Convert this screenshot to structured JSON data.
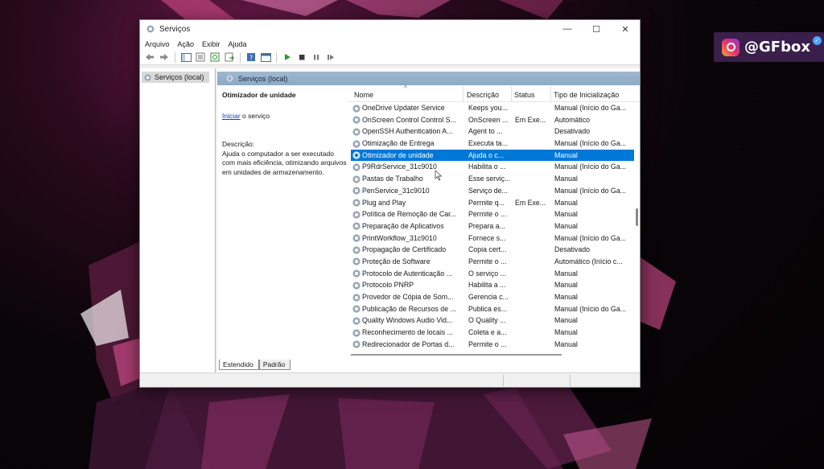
{
  "window": {
    "title": "Serviços",
    "menu": [
      "Arquivo",
      "Ação",
      "Exibir",
      "Ajuda"
    ]
  },
  "tree": {
    "root_label": "Serviços (local)"
  },
  "content": {
    "header": "Serviços (local)",
    "description_pane": {
      "service_title": "Otimizador de unidade",
      "start_link": "Iniciar",
      "start_suffix": " o serviço",
      "description_label": "Descrição:",
      "description_text": "Ajuda o computador a ser executado com mais eficiência, otimizando arquivos em unidades de armazenamento."
    },
    "columns": {
      "name": "Nome",
      "description": "Descrição",
      "status": "Status",
      "startup_type": "Tipo de Inicialização"
    },
    "services": [
      {
        "name": "OneDrive Updater Service",
        "description": "Keeps you...",
        "status": "",
        "startup": "Manual (Início do Ga..."
      },
      {
        "name": "OnScreen Control Control S...",
        "description": "OnScreen ...",
        "status": "Em Exe...",
        "startup": "Automático"
      },
      {
        "name": "OpenSSH Authentication A...",
        "description": "Agent to ...",
        "status": "",
        "startup": "Desativado"
      },
      {
        "name": "Otimização de Entrega",
        "description": "Executa ta...",
        "status": "",
        "startup": "Manual (Início do Ga..."
      },
      {
        "name": "Otimizador de unidade",
        "description": "Ajuda o c...",
        "status": "",
        "startup": "Manual",
        "selected": true
      },
      {
        "name": "P9RdrService_31c9010",
        "description": "Habilita o ...",
        "status": "",
        "startup": "Manual (Início do Ga..."
      },
      {
        "name": "Pastas de Trabalho",
        "description": "Esse serviç...",
        "status": "",
        "startup": "Manual"
      },
      {
        "name": "PenService_31c9010",
        "description": "Serviço de...",
        "status": "",
        "startup": "Manual (Início do Ga..."
      },
      {
        "name": "Plug and Play",
        "description": "Permite q...",
        "status": "Em Exe...",
        "startup": "Manual"
      },
      {
        "name": "Política de Remoção de Car...",
        "description": "Permite o ...",
        "status": "",
        "startup": "Manual"
      },
      {
        "name": "Preparação de Aplicativos",
        "description": "Prepara a...",
        "status": "",
        "startup": "Manual"
      },
      {
        "name": "PrintWorkflow_31c9010",
        "description": "Fornece s...",
        "status": "",
        "startup": "Manual (Início do Ga..."
      },
      {
        "name": "Propagação de Certificado",
        "description": "Copia cert...",
        "status": "",
        "startup": "Desativado"
      },
      {
        "name": "Proteção de Software",
        "description": "Permite o ...",
        "status": "",
        "startup": "Automático (Início c..."
      },
      {
        "name": "Protocolo de Autenticação ...",
        "description": "O serviço ...",
        "status": "",
        "startup": "Manual"
      },
      {
        "name": "Protocolo PNRP",
        "description": "Habilita a ...",
        "status": "",
        "startup": "Manual"
      },
      {
        "name": "Provedor de Cópia de Som...",
        "description": "Gerencia c...",
        "status": "",
        "startup": "Manual"
      },
      {
        "name": "Publicação de Recursos de ...",
        "description": "Publica es...",
        "status": "",
        "startup": "Manual (Início do Ga..."
      },
      {
        "name": "Quality Windows Audio Vid...",
        "description": "O Quality ...",
        "status": "",
        "startup": "Manual"
      },
      {
        "name": "Reconhecimento de locais ...",
        "description": "Coleta e a...",
        "status": "",
        "startup": "Manual"
      },
      {
        "name": "Redirecionador de Portas d...",
        "description": "Permite o ...",
        "status": "",
        "startup": "Manual"
      }
    ],
    "tabs": [
      "Estendido",
      "Padrão"
    ]
  },
  "overlay": {
    "handle": "@GFbox"
  },
  "colors": {
    "selection": "#0078d7",
    "header_band": "#9fb8cf",
    "badge_bg": "#3a1f4a"
  }
}
